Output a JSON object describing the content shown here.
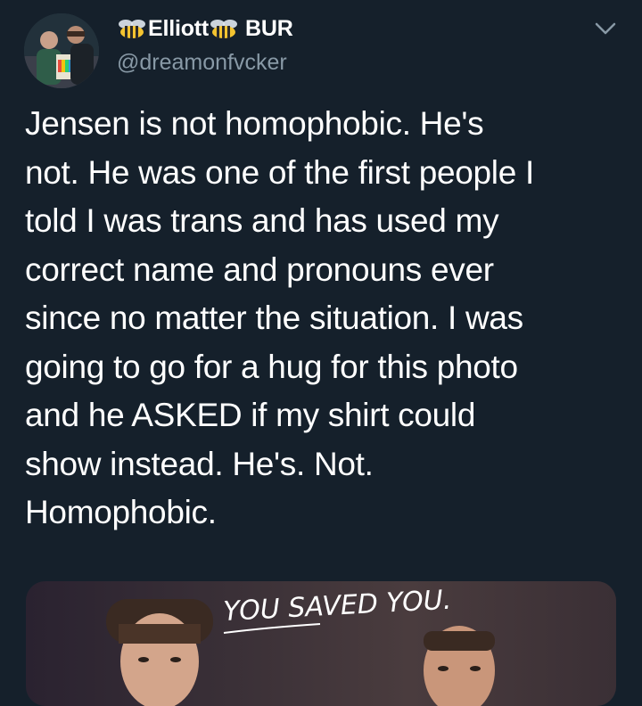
{
  "tweet": {
    "display_name_part1": "Elliott",
    "display_name_part2": "BUR",
    "handle": "@dreamonfvcker",
    "text": "Jensen is not homophobic. He's\nnot. He was one of the first people I\ntold I was trans and has used my\ncorrect name and pronouns ever\nsince no matter the situation. I was\ngoing to go for a hug for this photo\nand he ASKED if my shirt could\nshow instead. He's. Not.\nHomophobic.",
    "media_caption": "YOU SAVED YOU.",
    "icons": {
      "name_emoji": "bee-icon",
      "menu": "chevron-down-icon"
    }
  },
  "colors": {
    "background": "#15202b",
    "text": "#ffffff",
    "secondary_text": "#8899a6"
  }
}
